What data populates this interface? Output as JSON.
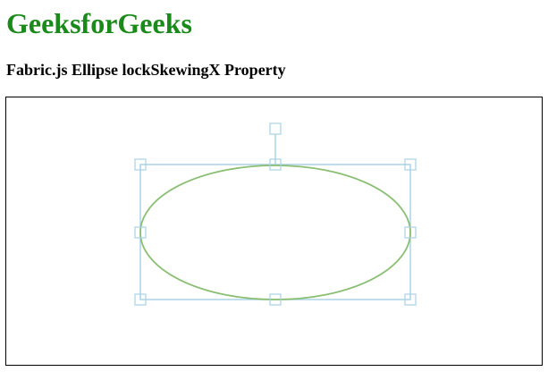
{
  "header": {
    "title": "GeeksforGeeks",
    "subtitle": "Fabric.js Ellipse lockSkewingX Property"
  },
  "colors": {
    "title": "#1a8a1a",
    "ellipse_stroke": "#8abf73",
    "selection_border": "#aad2e6",
    "canvas_border": "#000000"
  },
  "canvas": {
    "object": "ellipse",
    "selected": true,
    "controls": [
      "top-left",
      "top-center",
      "top-right",
      "middle-left",
      "middle-right",
      "bottom-left",
      "bottom-center",
      "bottom-right",
      "rotate"
    ]
  }
}
